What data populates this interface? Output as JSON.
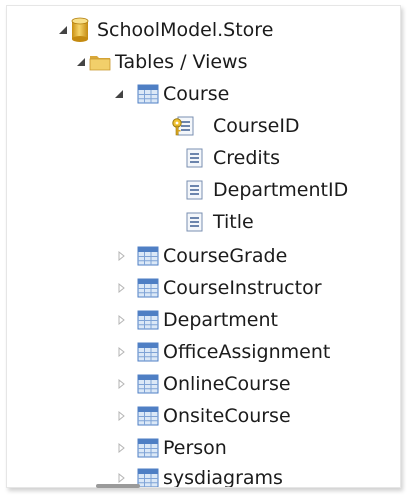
{
  "tree": {
    "root": {
      "label": "SchoolModel.Store",
      "icon": "database-icon",
      "expanded": true
    },
    "folder": {
      "label": "Tables / Views",
      "icon": "folder-icon",
      "expanded": true
    },
    "course": {
      "label": "Course",
      "icon": "table-icon",
      "expanded": true
    },
    "columns": [
      {
        "label": "CourseID",
        "icon": "primary-key-column-icon"
      },
      {
        "label": "Credits",
        "icon": "column-icon"
      },
      {
        "label": "DepartmentID",
        "icon": "column-icon"
      },
      {
        "label": "Title",
        "icon": "column-icon"
      }
    ],
    "tables": [
      {
        "label": "CourseGrade",
        "icon": "table-icon"
      },
      {
        "label": "CourseInstructor",
        "icon": "table-icon"
      },
      {
        "label": "Department",
        "icon": "table-icon"
      },
      {
        "label": "OfficeAssignment",
        "icon": "table-icon"
      },
      {
        "label": "OnlineCourse",
        "icon": "table-icon"
      },
      {
        "label": "OnsiteCourse",
        "icon": "table-icon"
      },
      {
        "label": "Person",
        "icon": "table-icon"
      },
      {
        "label": "sysdiagrams",
        "icon": "table-icon"
      }
    ]
  },
  "colors": {
    "text": "#1b1b1b",
    "table_header": "#4f7fc4",
    "table_cell": "#dbe8f7",
    "db_gold": "#e6b430",
    "folder": "#e9c257",
    "expanded_arrow": "#444444",
    "collapsed_arrow": "#b5b5b5"
  }
}
